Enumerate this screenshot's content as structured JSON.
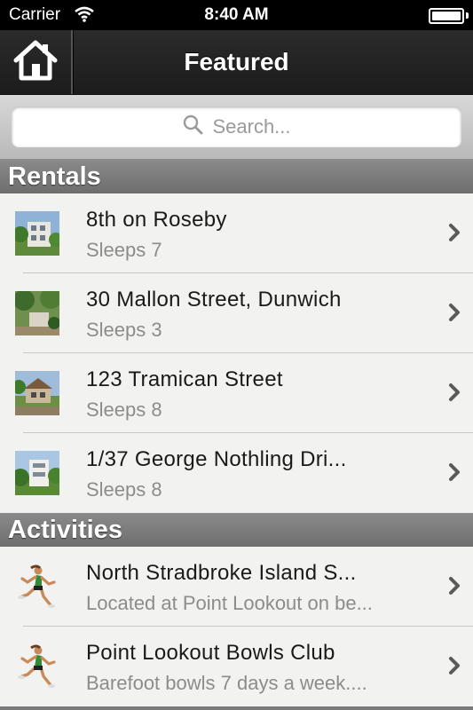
{
  "status_bar": {
    "carrier": "Carrier",
    "time": "8:40 AM"
  },
  "nav": {
    "title": "Featured",
    "home_icon": "home-icon"
  },
  "search": {
    "placeholder": "Search..."
  },
  "sections": {
    "rentals": {
      "title": "Rentals",
      "items": [
        {
          "title": "8th on Roseby",
          "subtitle": "Sleeps 7"
        },
        {
          "title": "30 Mallon Street, Dunwich",
          "subtitle": "Sleeps 3"
        },
        {
          "title": "123 Tramican Street",
          "subtitle": "Sleeps 8"
        },
        {
          "title": "1/37 George Nothling Dri...",
          "subtitle": "Sleeps 8"
        }
      ]
    },
    "activities": {
      "title": "Activities",
      "items": [
        {
          "title": "North Stradbroke Island S...",
          "subtitle": "Located at Point Lookout on be..."
        },
        {
          "title": "Point Lookout Bowls Club",
          "subtitle": "Barefoot bowls 7 days a week...."
        }
      ]
    }
  },
  "colors": {
    "navbar": "#222222",
    "section_header": "#7a7a7a",
    "subtitle": "#8c8c8c"
  }
}
